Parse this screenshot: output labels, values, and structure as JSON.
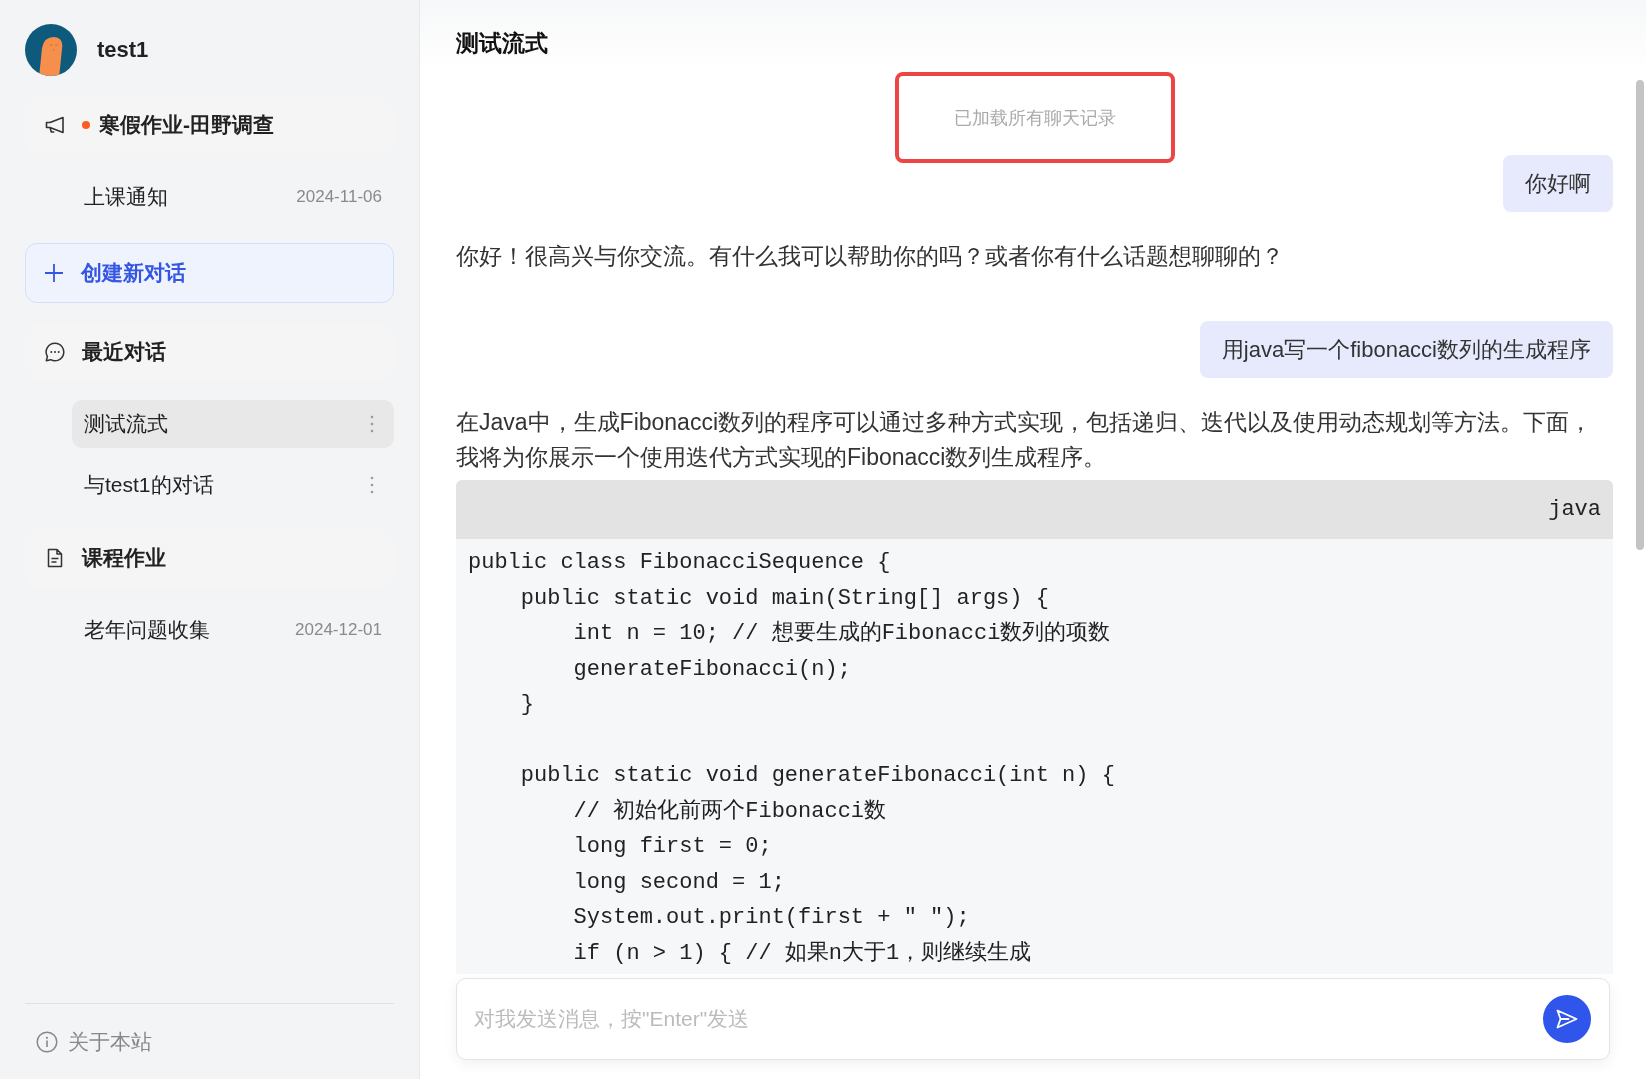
{
  "user": {
    "name": "test1"
  },
  "notice": {
    "title": "寒假作业-田野调查",
    "unread": true,
    "items": [
      {
        "title": "上课通知",
        "date": "2024-11-06"
      }
    ]
  },
  "new_chat_button": {
    "label": "创建新对话"
  },
  "recent_chats": {
    "title": "最近对话",
    "items": [
      {
        "title": "测试流式",
        "selected": true
      },
      {
        "title": "与test1的对话",
        "selected": false
      }
    ]
  },
  "assignments": {
    "title": "课程作业",
    "items": [
      {
        "title": "老年问题收集",
        "date": "2024-12-01"
      }
    ]
  },
  "footer": {
    "about_link": "关于本站"
  },
  "chat": {
    "title": "测试流式",
    "history_notice": {
      "text": "已加载所有聊天记录",
      "highlighted": true
    },
    "messages": [
      {
        "kind": "user",
        "text": "你好啊"
      },
      {
        "kind": "assistant",
        "blocks": [
          {
            "kind": "paragraph",
            "text": "你好！很高兴与你交流。有什么我可以帮助你的吗？或者你有什么话题想聊聊的？"
          }
        ]
      },
      {
        "kind": "user",
        "text": "用java写一个fibonacci数列的生成程序"
      },
      {
        "kind": "assistant",
        "blocks": [
          {
            "kind": "paragraph",
            "text": "在Java中，生成Fibonacci数列的程序可以通过多种方式实现，包括递归、迭代以及使用动态规划等方法。下面，我将为你展示一个使用迭代方式实现的Fibonacci数列生成程序。"
          },
          {
            "kind": "code",
            "language": "java",
            "code": "public class FibonacciSequence {\n    public static void main(String[] args) {\n        int n = 10; // 想要生成的Fibonacci数列的项数\n        generateFibonacci(n);\n    }\n\n    public static void generateFibonacci(int n) {\n        // 初始化前两个Fibonacci数\n        long first = 0;\n        long second = 1;\n        System.out.print(first + \" \");\n        if (n > 1) { // 如果n大于1，则继续生成"
          }
        ]
      }
    ],
    "input": {
      "placeholder": "对我发送消息，按\"Enter\"发送"
    }
  }
}
